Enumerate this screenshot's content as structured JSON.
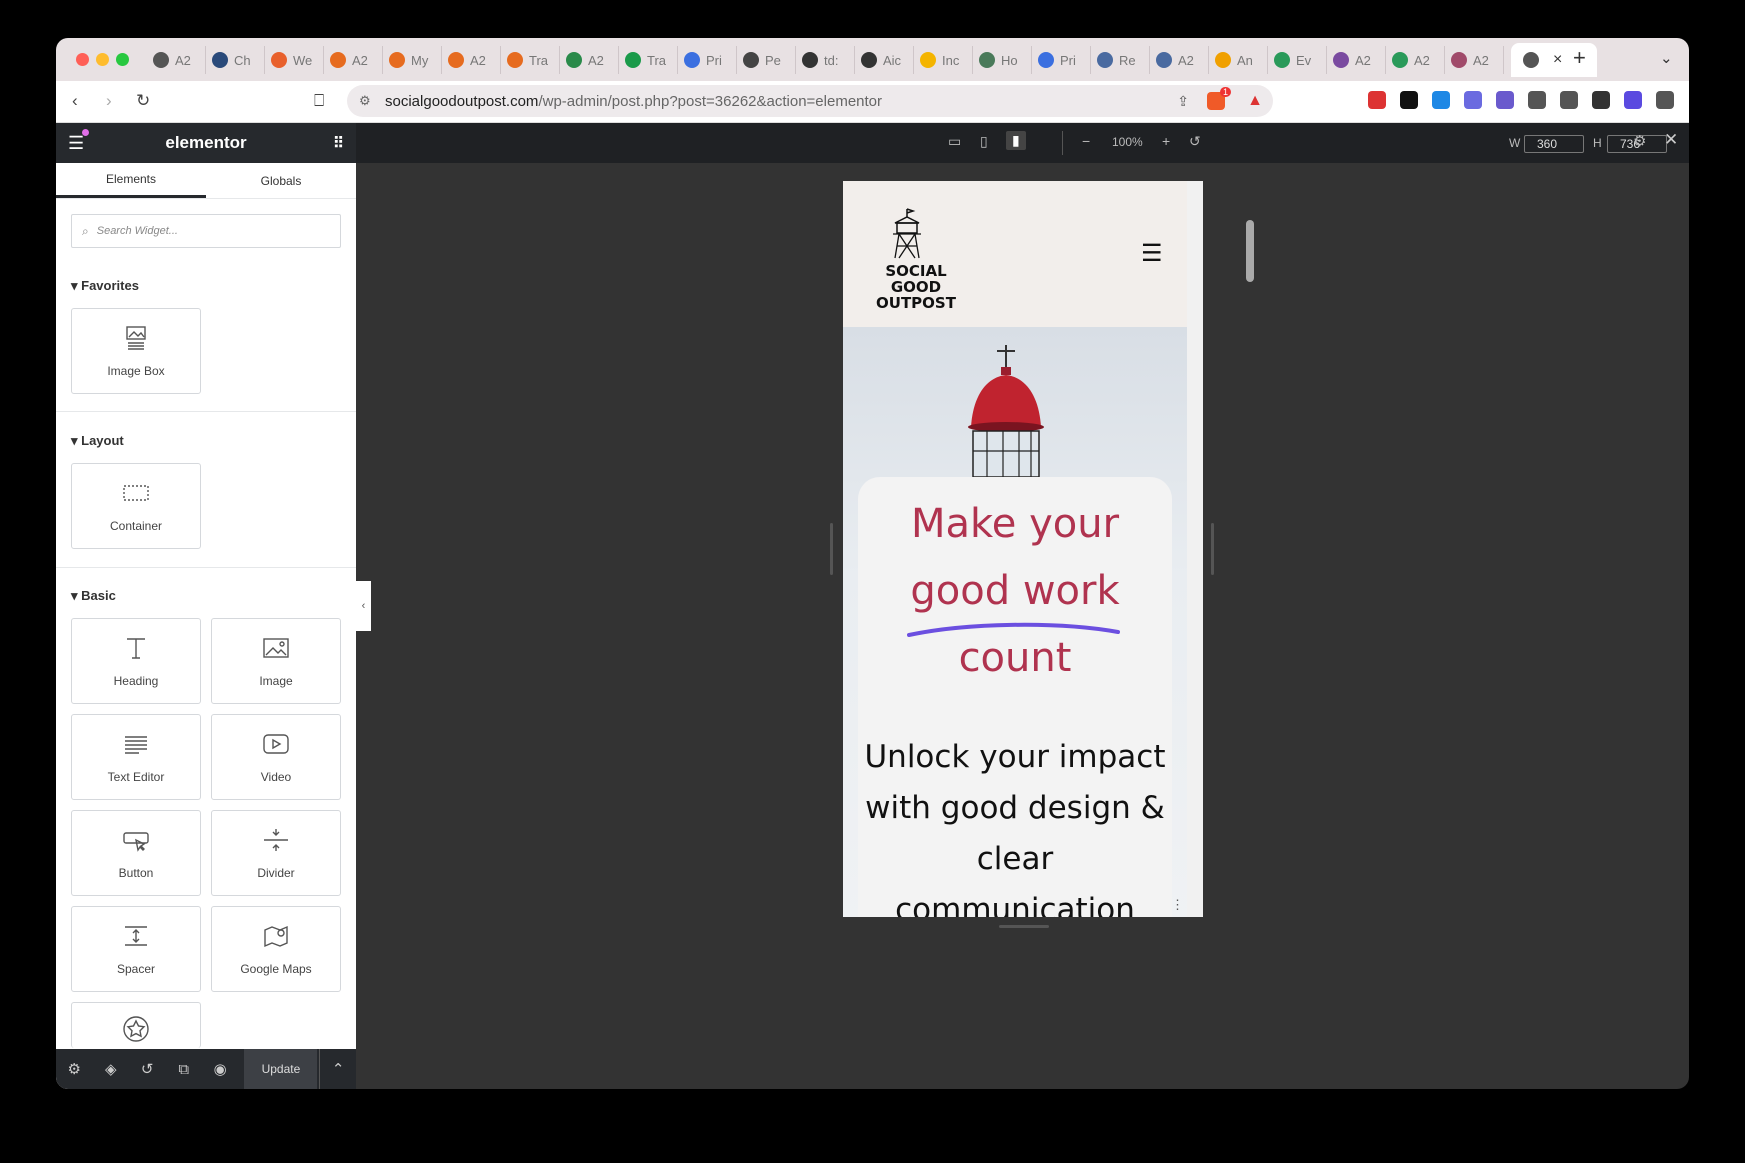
{
  "browser": {
    "tabs": [
      "A2",
      "Ch",
      "We",
      "A2",
      "My",
      "A2",
      "Tra",
      "A2",
      "Tra",
      "Pri",
      "Pe",
      "td:",
      "Aic",
      "Inc",
      "Ho",
      "Pri",
      "Re",
      "A2",
      "An",
      "Ev",
      "A2",
      "A2",
      "A2"
    ],
    "active_tab_close": "×",
    "new_tab": "+",
    "url_domain": "socialgoodoutpost.com",
    "url_path": "/wp-admin/post.php?post=36262&action=elementor",
    "brave_badge": "1"
  },
  "panel": {
    "logo": "elementor",
    "tabs": [
      "Elements",
      "Globals"
    ],
    "search_placeholder": "Search Widget...",
    "sections": {
      "favorites": "Favorites",
      "layout": "Layout",
      "basic": "Basic"
    },
    "widgets": {
      "image_box": "Image Box",
      "container": "Container",
      "heading": "Heading",
      "image": "Image",
      "text_editor": "Text Editor",
      "video": "Video",
      "button": "Button",
      "divider": "Divider",
      "spacer": "Spacer",
      "google_maps": "Google Maps"
    },
    "update_label": "Update"
  },
  "editor": {
    "zoom": "100%",
    "width_label": "W",
    "width_value": "360",
    "height_label": "H",
    "height_value": "736"
  },
  "page": {
    "logo_line1": "SOCIAL GOOD",
    "logo_line2": "OUTPOST",
    "headline_1": "Make your",
    "headline_2": "good work",
    "headline_3": "count",
    "subhead_1": "Unlock your impact",
    "subhead_2": "with good design &",
    "subhead_3": "clear communication"
  },
  "colors": {
    "accent": "#b0334f",
    "underline": "#6b4fe0",
    "panel_dark": "#26292d"
  }
}
